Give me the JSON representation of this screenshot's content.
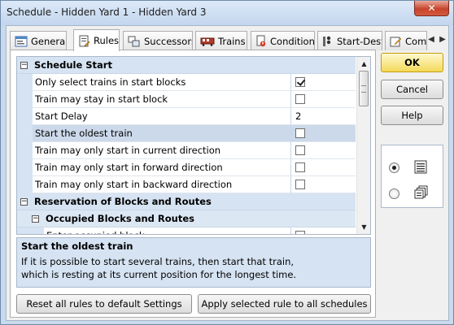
{
  "window": {
    "title": "Schedule - Hidden Yard 1 - Hidden Yard 3",
    "close_label": "✕"
  },
  "tabs": [
    {
      "label": "General",
      "icon": "general-tab-icon"
    },
    {
      "label": "Rules",
      "icon": "rules-tab-icon",
      "active": true
    },
    {
      "label": "Successors",
      "icon": "successors-tab-icon"
    },
    {
      "label": "Trains",
      "icon": "trains-tab-icon"
    },
    {
      "label": "Condition",
      "icon": "condition-tab-icon"
    },
    {
      "label": "Start-Dest",
      "icon": "start-dest-tab-icon"
    },
    {
      "label": "Com",
      "icon": "comment-tab-icon"
    }
  ],
  "tab_scroll": {
    "left": "◀",
    "right": "▶"
  },
  "grid": {
    "category_start": {
      "sign": "−",
      "label": "Schedule Start"
    },
    "rows": [
      {
        "name": "Only select trains in start blocks",
        "type": "check",
        "checked": true
      },
      {
        "name": "Train may stay in start block",
        "type": "check",
        "checked": false
      },
      {
        "name": "Start Delay",
        "type": "text",
        "value": "2"
      },
      {
        "name": "Start the oldest train",
        "type": "check",
        "checked": false,
        "selected": true
      },
      {
        "name": "Train may only start in current direction",
        "type": "check",
        "checked": false
      },
      {
        "name": "Train may only start in forward direction",
        "type": "check",
        "checked": false
      },
      {
        "name": "Train may only start in backward direction",
        "type": "check",
        "checked": false
      }
    ],
    "category_reservation": {
      "sign": "−",
      "label": "Reservation of Blocks and Routes"
    },
    "subcategory_occupied": {
      "sign": "−",
      "label": "Occupied Blocks and Routes"
    },
    "partial_row": {
      "name": "Enter occupied block"
    },
    "scroll_up": "▲",
    "scroll_down": "▼"
  },
  "description": {
    "title": "Start the oldest train",
    "line1": "If it is possible to start several trains, then start that train,",
    "line2": "which is resting at its current position for the longest time."
  },
  "buttons": {
    "reset": "Reset all rules to default Settings",
    "apply": "Apply selected rule to all schedules",
    "ok": "OK",
    "cancel": "Cancel",
    "help": "Help"
  },
  "view_mode": {
    "selected": "single",
    "options": [
      "single-view-icon",
      "multi-view-icon"
    ]
  }
}
